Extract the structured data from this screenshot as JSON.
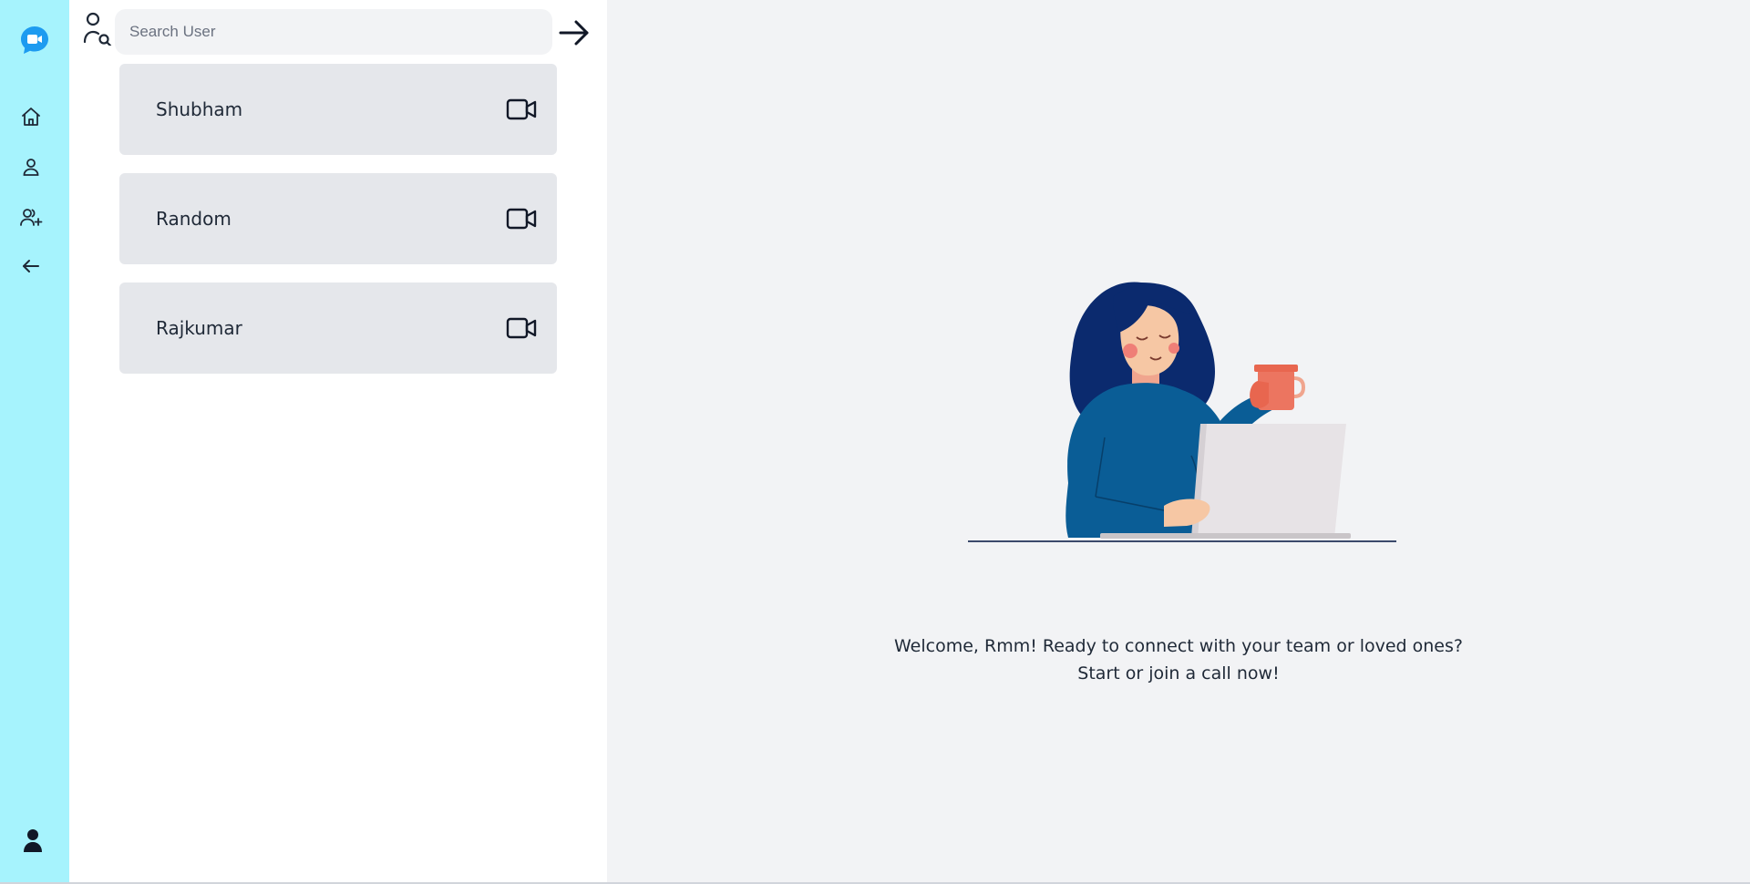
{
  "colors": {
    "rail_background": "#a6f3fd",
    "panel_background": "#ffffff",
    "main_background": "#f2f3f5",
    "card_background": "#e5e7eb",
    "logo_blue": "#1d9bf0",
    "text_dark": "#1f2937"
  },
  "rail": {
    "icons": [
      "video-chat-logo-icon",
      "home-icon",
      "user-icon",
      "add-user-icon",
      "arrow-left-icon",
      "profile-icon"
    ]
  },
  "search": {
    "placeholder": "Search User",
    "value": ""
  },
  "users": [
    {
      "name": "Shubham",
      "icon": "video-camera-icon"
    },
    {
      "name": "Random",
      "icon": "video-camera-icon"
    },
    {
      "name": "Rajkumar",
      "icon": "video-camera-icon"
    }
  ],
  "main": {
    "welcome_line1": "Welcome, Rmm! Ready to connect with your team or loved ones?",
    "welcome_line2": "Start or join a call now!"
  }
}
